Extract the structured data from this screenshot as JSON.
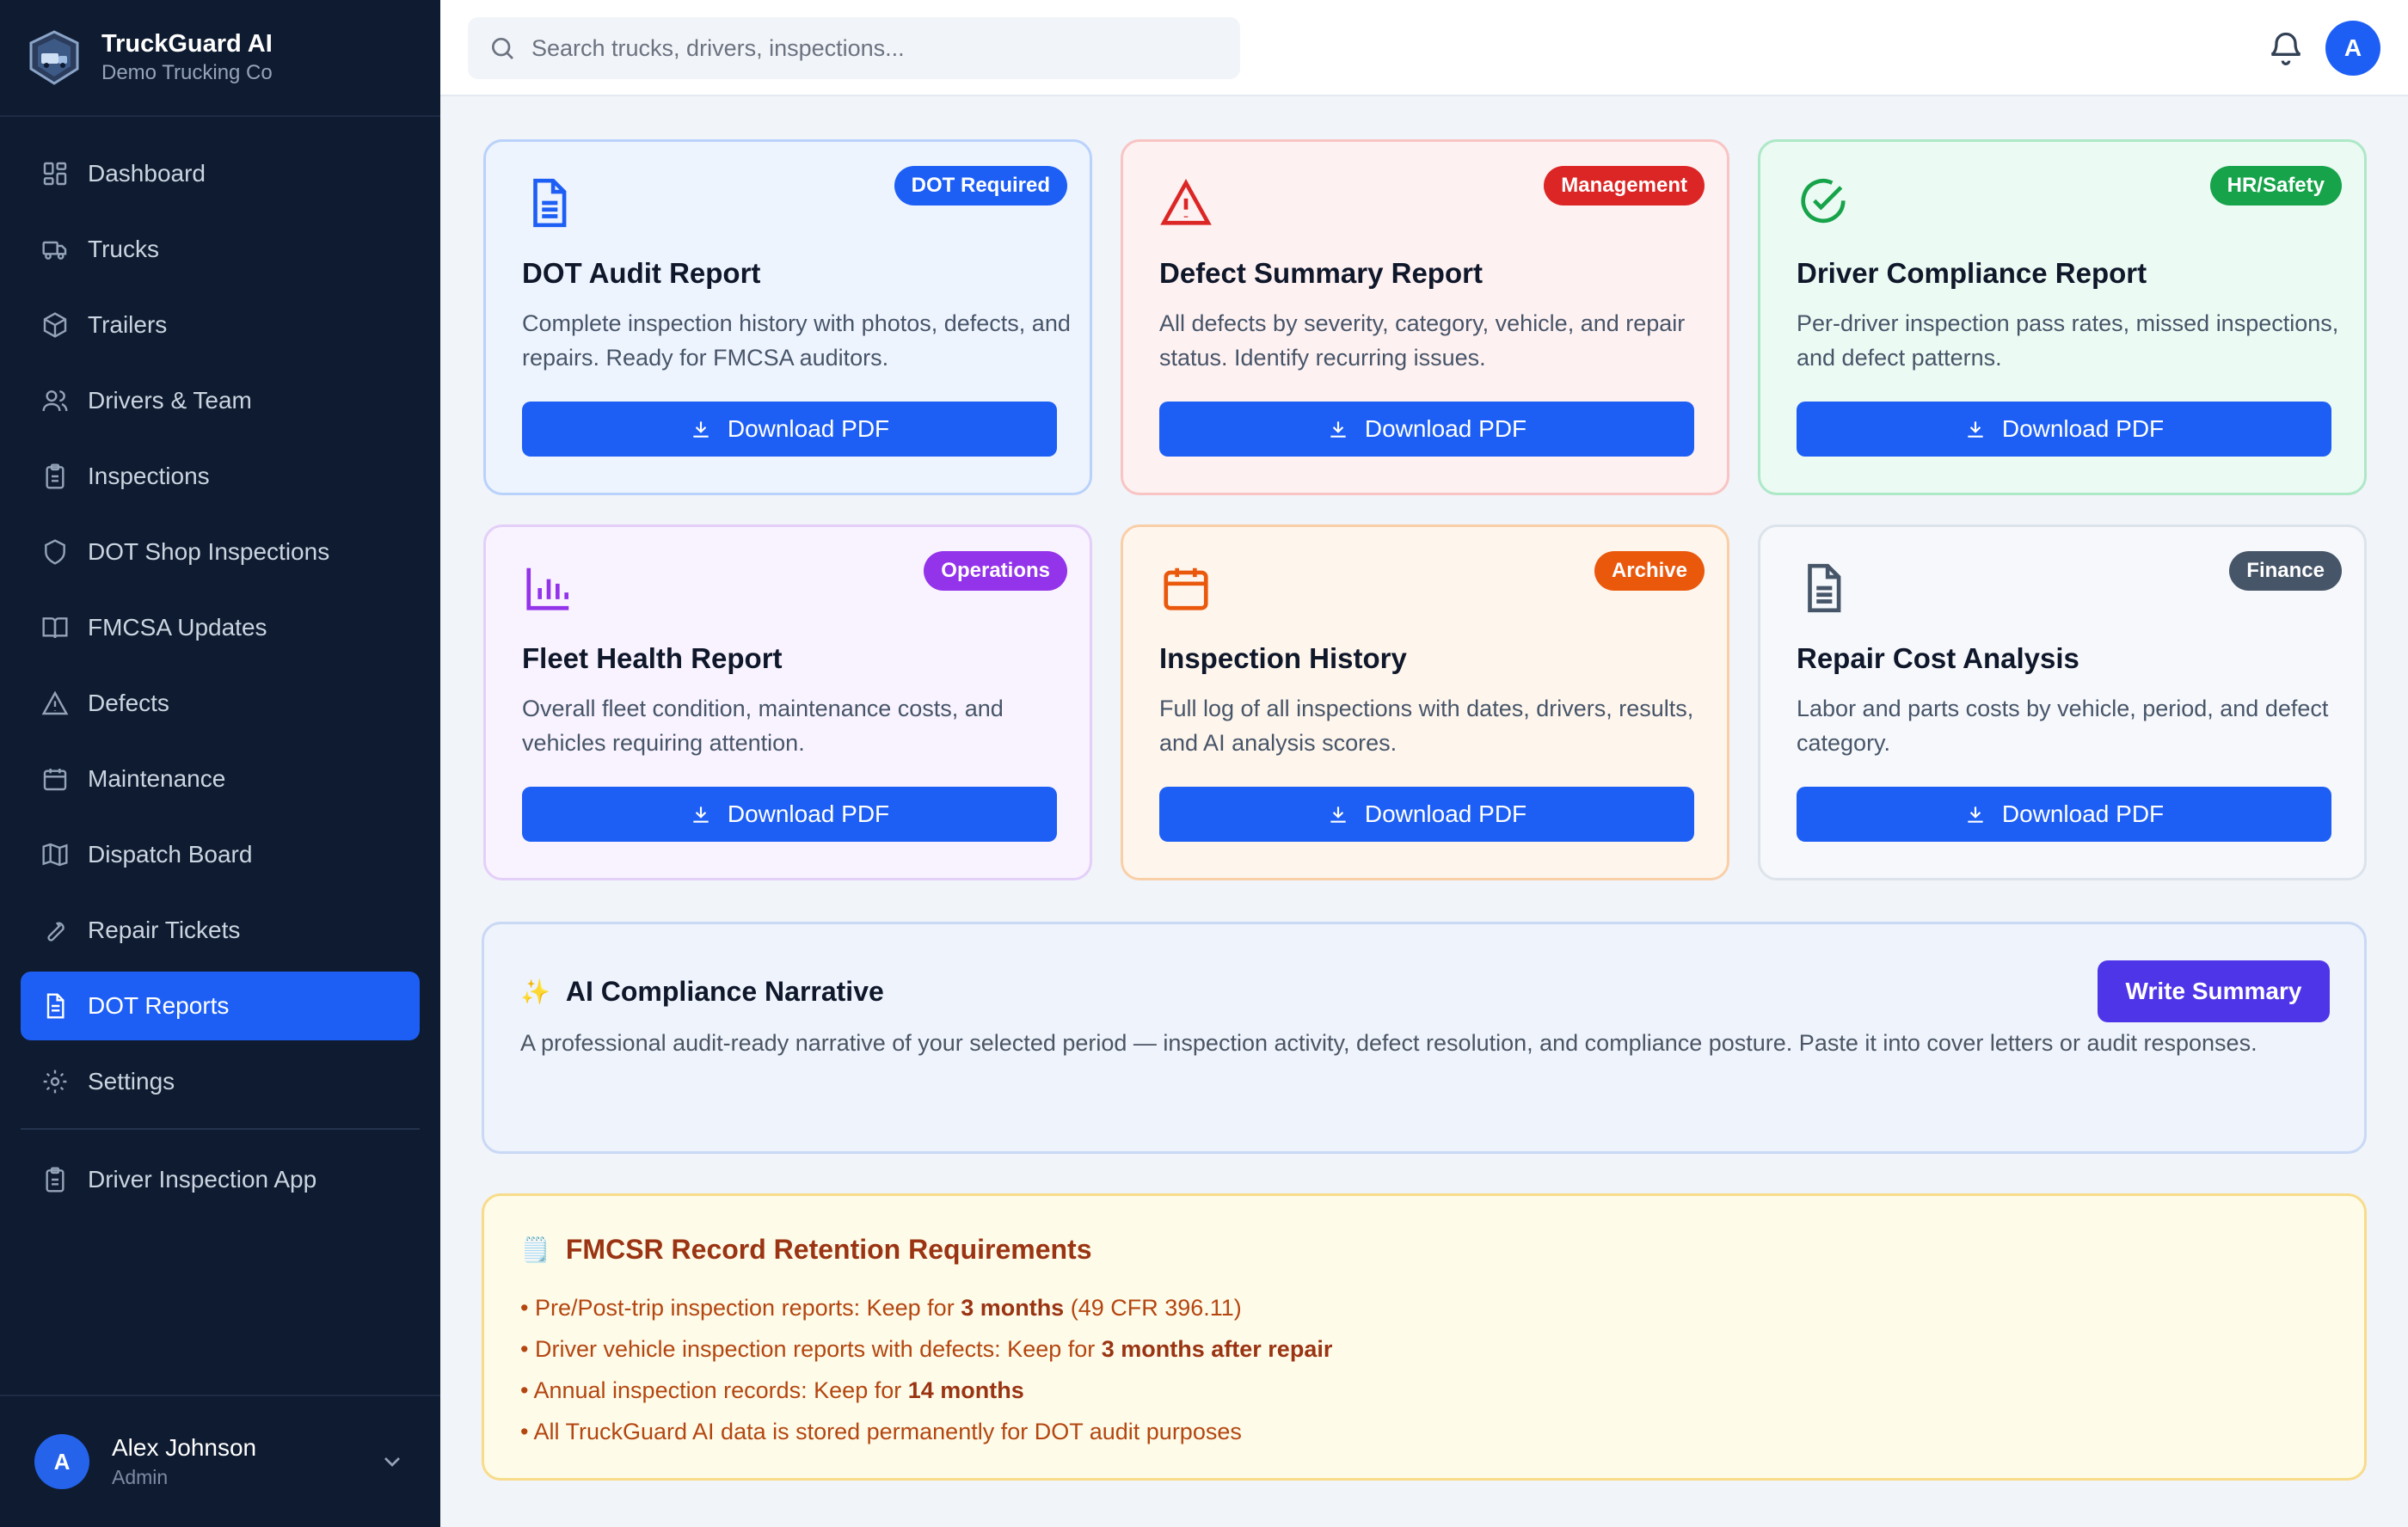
{
  "brand": {
    "title": "TruckGuard AI",
    "subtitle": "Demo Trucking Co"
  },
  "nav": [
    {
      "label": "Dashboard",
      "icon": "grid-icon"
    },
    {
      "label": "Trucks",
      "icon": "truck-icon"
    },
    {
      "label": "Trailers",
      "icon": "box-icon"
    },
    {
      "label": "Drivers & Team",
      "icon": "users-icon"
    },
    {
      "label": "Inspections",
      "icon": "clipboard-icon"
    },
    {
      "label": "DOT Shop Inspections",
      "icon": "shield-icon"
    },
    {
      "label": "FMCSA Updates",
      "icon": "book-icon"
    },
    {
      "label": "Defects",
      "icon": "warning-icon"
    },
    {
      "label": "Maintenance",
      "icon": "calendar-icon"
    },
    {
      "label": "Dispatch Board",
      "icon": "map-icon"
    },
    {
      "label": "Repair Tickets",
      "icon": "wrench-icon"
    },
    {
      "label": "DOT Reports",
      "icon": "file-icon",
      "active": true
    },
    {
      "label": "Settings",
      "icon": "gear-icon"
    }
  ],
  "nav_extra": {
    "label": "Driver Inspection App",
    "icon": "clipboard-icon"
  },
  "user": {
    "initial": "A",
    "name": "Alex Johnson",
    "role": "Admin"
  },
  "topbar": {
    "search_placeholder": "Search trucks, drivers, inspections...",
    "avatar_initial": "A"
  },
  "cards": [
    {
      "title": "DOT Audit Report",
      "badge": "DOT Required",
      "desc": "Complete inspection history with photos, defects, and repairs. Ready for FMCSA auditors.",
      "button": "Download PDF",
      "icon": "file-text-icon",
      "accent": "#1d5ff5",
      "bg": "#eef4fe",
      "border": "#b9d2fb"
    },
    {
      "title": "Defect Summary Report",
      "badge": "Management",
      "desc": "All defects by severity, category, vehicle, and repair status. Identify recurring issues.",
      "button": "Download PDF",
      "icon": "alert-triangle-icon",
      "accent": "#dc2626",
      "bg": "#fef1f1",
      "border": "#f8c4c4"
    },
    {
      "title": "Driver Compliance Report",
      "badge": "HR/Safety",
      "desc": "Per-driver inspection pass rates, missed inspections, and defect patterns.",
      "button": "Download PDF",
      "icon": "check-circle-icon",
      "accent": "#16a34a",
      "bg": "#ebfaf2",
      "border": "#ade8c7"
    },
    {
      "title": "Fleet Health Report",
      "badge": "Operations",
      "desc": "Overall fleet condition, maintenance costs, and vehicles requiring attention.",
      "button": "Download PDF",
      "icon": "bar-chart-icon",
      "accent": "#9333ea",
      "bg": "#f8f3fe",
      "border": "#e4cff9"
    },
    {
      "title": "Inspection History",
      "badge": "Archive",
      "desc": "Full log of all inspections with dates, drivers, results, and AI analysis scores.",
      "button": "Download PDF",
      "icon": "calendar-icon",
      "accent": "#ea580c",
      "bg": "#fef5ec",
      "border": "#f9cfa7"
    },
    {
      "title": "Repair Cost Analysis",
      "badge": "Finance",
      "desc": "Labor and parts costs by vehicle, period, and defect category.",
      "button": "Download PDF",
      "icon": "file-text-icon",
      "accent": "#475569",
      "bg": "#f6f8fb",
      "border": "#dde3eb"
    }
  ],
  "narrative": {
    "title": "AI Compliance Narrative",
    "text": "A professional audit-ready narrative of your selected period — inspection activity, defect resolution, and compliance posture. Paste it into cover letters or audit responses.",
    "button": "Write Summary"
  },
  "retention": {
    "title": "FMCSR Record Retention Requirements",
    "items": [
      {
        "pre": "• Pre/Post-trip inspection reports: Keep for ",
        "bold": "3 months",
        "post": " (49 CFR 396.11)"
      },
      {
        "pre": "• Driver vehicle inspection reports with defects: Keep for ",
        "bold": "3 months after repair",
        "post": ""
      },
      {
        "pre": "• Annual inspection records: Keep for ",
        "bold": "14 months",
        "post": ""
      },
      {
        "pre": "• All TruckGuard AI data is stored permanently for DOT audit purposes",
        "bold": "",
        "post": ""
      }
    ]
  }
}
